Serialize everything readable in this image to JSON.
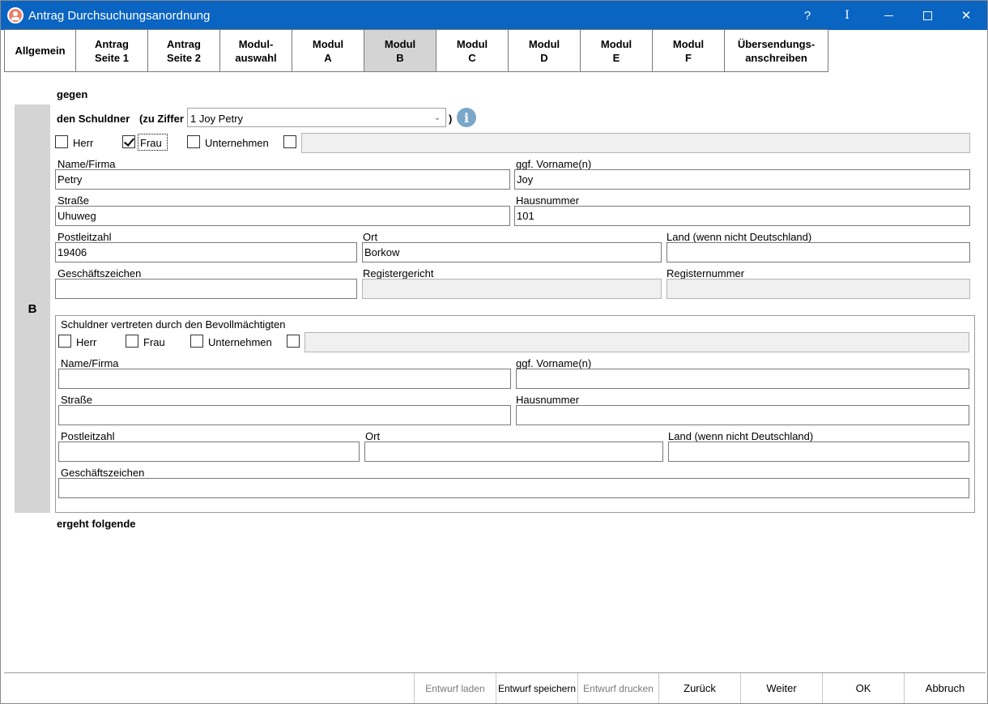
{
  "window": {
    "title": "Antrag Durchsuchungsanordnung",
    "help_glyph": "?",
    "cursor_glyph": "I",
    "close_glyph": "✕"
  },
  "tabs": [
    {
      "label": "Allgemein"
    },
    {
      "label": "Antrag\nSeite 1"
    },
    {
      "label": "Antrag\nSeite 2"
    },
    {
      "label": "Modul-\nauswahl"
    },
    {
      "label": "Modul\nA"
    },
    {
      "label": "Modul\nB",
      "active": true
    },
    {
      "label": "Modul\nC"
    },
    {
      "label": "Modul\nD"
    },
    {
      "label": "Modul\nE"
    },
    {
      "label": "Modul\nF"
    },
    {
      "label": "Übersendungs-\nanschreiben"
    }
  ],
  "section": {
    "gegen": "gegen",
    "side_letter": "B",
    "schuldner_label": "den Schuldner",
    "ziffer_label": "(zu Ziffer",
    "ziffer_close": ")",
    "ziffer_value": "1  Joy Petry",
    "info_glyph": "i",
    "footer_text": "ergeht folgende"
  },
  "debtor": {
    "salutations": [
      {
        "label": "Herr",
        "checked": false
      },
      {
        "label": "Frau",
        "checked": true
      },
      {
        "label": "Unternehmen",
        "checked": false
      }
    ],
    "name_label": "Name/Firma",
    "name_value": "Petry",
    "vorname_label": "ggf. Vorname(n)",
    "vorname_value": "Joy",
    "strasse_label": "Straße",
    "strasse_value": "Uhuweg",
    "hausnr_label": "Hausnummer",
    "hausnr_value": "101",
    "plz_label": "Postleitzahl",
    "plz_value": "19406",
    "ort_label": "Ort",
    "ort_value": "Borkow",
    "land_label": "Land (wenn nicht Deutschland)",
    "land_value": "",
    "gz_label": "Geschäftszeichen",
    "gz_value": "",
    "registergericht_label": "Registergericht",
    "registernummer_label": "Registernummer"
  },
  "representative": {
    "title": "Schuldner vertreten durch den Bevollmächtigten",
    "salutations": [
      {
        "label": "Herr",
        "checked": false
      },
      {
        "label": "Frau",
        "checked": false
      },
      {
        "label": "Unternehmen",
        "checked": false
      }
    ],
    "name_label": "Name/Firma",
    "vorname_label": "ggf. Vorname(n)",
    "strasse_label": "Straße",
    "hausnr_label": "Hausnummer",
    "plz_label": "Postleitzahl",
    "ort_label": "Ort",
    "land_label": "Land (wenn nicht Deutschland)",
    "gz_label": "Geschäftszeichen"
  },
  "footer": {
    "buttons": [
      {
        "label": "Entwurf laden",
        "enabled": false
      },
      {
        "label": "Entwurf speichern",
        "enabled": true
      },
      {
        "label": "Entwurf drucken",
        "enabled": false
      },
      {
        "label": "Zurück",
        "enabled": true
      },
      {
        "label": "Weiter",
        "enabled": true
      },
      {
        "label": "OK",
        "enabled": true
      },
      {
        "label": "Abbruch",
        "enabled": true
      }
    ]
  },
  "colors": {
    "titlebar": "#0a64c2",
    "active_tab": "#d4d4d4",
    "side_bar": "#d4d4d4",
    "disabled_field": "#f0f0f0"
  }
}
